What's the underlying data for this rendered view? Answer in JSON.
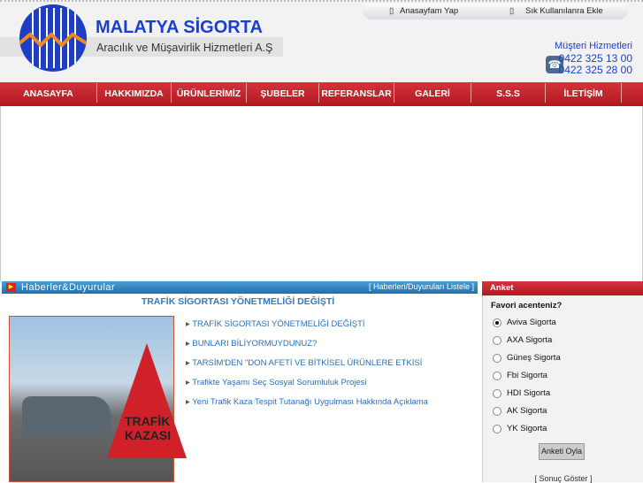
{
  "header": {
    "brand": "MALATYA SİGORTA",
    "subtitle": "Aracılık ve Müşavirlik Hizmetleri A.Ş",
    "links": [
      "Anasayfam Yap",
      "Sık Kullanılanra Ekle"
    ],
    "customer_service": "Müşteri Hizmetleri",
    "phones": [
      "0422 325 13 00",
      "0422 325 28 00"
    ]
  },
  "nav": [
    "ANASAYFA",
    "HAKKIMIZDA",
    "ÜRÜNLERİMİZ",
    "ŞUBELER",
    "REFERANSLAR",
    "GALERİ",
    "S.S.S",
    "İLETİŞİM"
  ],
  "news": {
    "title": "Haberler&Duyurular",
    "list_link": "[ Haberleri/Duyuruları Listele ]",
    "headline": "TRAFİK SİGORTASI YÖNETMELİĞİ DEĞİŞTİ",
    "image_text": "TRAFİK KAZASI",
    "items": [
      "TRAFİK SİGORTASI YÖNETMELİĞİ DEĞİŞTİ",
      "BUNLARI BİLİYORMUYDUNUZ?",
      "TARSİM'DEN \"DON AFETİ VE BİTKİSEL ÜRÜNLERE ETKİSİ",
      "Trafikte Yaşamı Seç Sosyal Sorumluluk Projesi",
      "Yeni Trafik Kaza Tespit Tutanağı Uygulması Hakkında Açıklama"
    ]
  },
  "poll": {
    "title": "Anket",
    "question": "Favori acenteniz?",
    "options": [
      "Aviva Sigorta",
      "AXA Sigorta",
      "Güneş Sigorta",
      "Fbi Sigorta",
      "HDI Sigorta",
      "AK Sigorta",
      "YK Sigorta"
    ],
    "selected": "Aviva Sigorta",
    "vote": "Anketi Oyla",
    "results": "[ Sonuç Göster ]"
  }
}
